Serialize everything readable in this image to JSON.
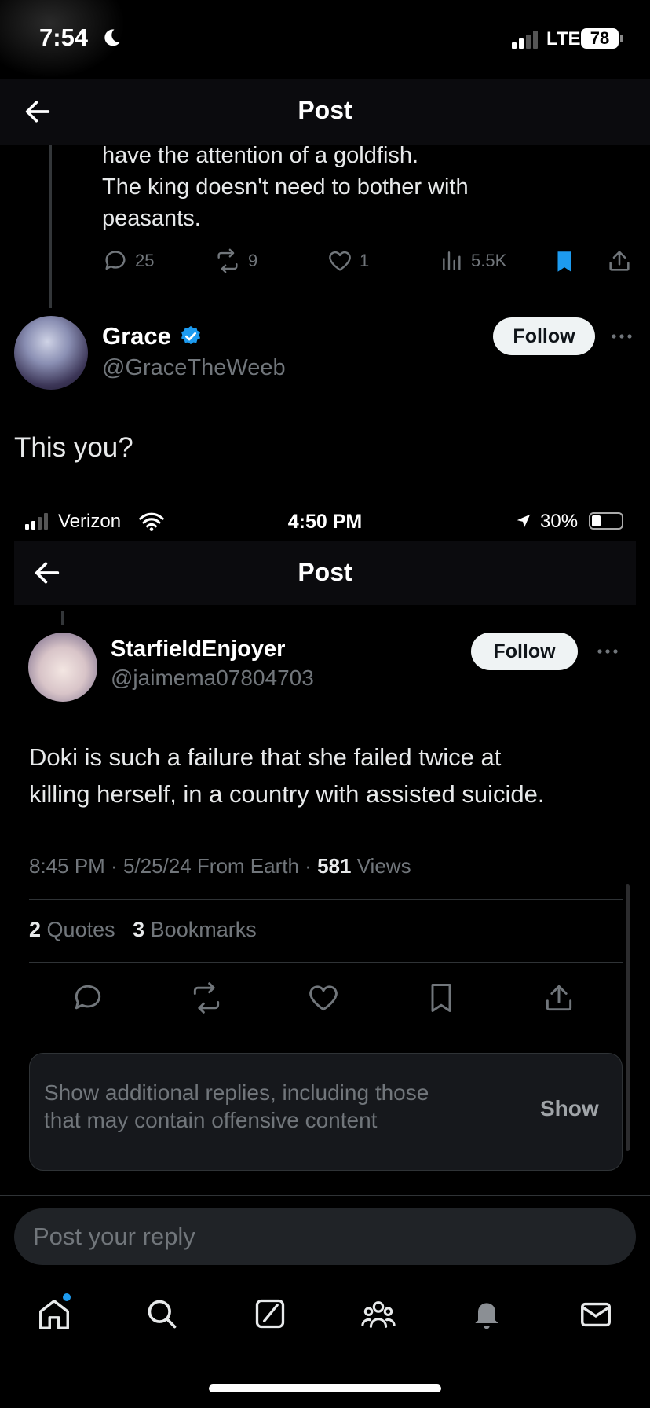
{
  "status_bar": {
    "time": "7:54",
    "network": "LTE",
    "battery": "78"
  },
  "header": {
    "title": "Post"
  },
  "prior_post": {
    "lines": [
      "have the attention of a goldfish.",
      "The king doesn't need to bother with",
      "peasants."
    ],
    "replies": "25",
    "reposts": "9",
    "likes": "1",
    "views": "5.5K"
  },
  "reply_post": {
    "display_name": "Grace",
    "handle": "@GraceTheWeeb",
    "follow_label": "Follow",
    "text": "This you?"
  },
  "embedded": {
    "status": {
      "carrier": "Verizon",
      "time": "4:50 PM",
      "battery": "30%"
    },
    "header_title": "Post",
    "author": {
      "display_name": "StarfieldEnjoyer",
      "handle": "@jaimema07804703",
      "follow_label": "Follow"
    },
    "text_line1": "Doki is such a failure that she failed twice at",
    "text_line2": "killing herself, in a country with assisted suicide.",
    "meta": {
      "time": "8:45 PM",
      "date": "5/25/24",
      "source": "From Earth",
      "views_count": "581",
      "views_label": "Views"
    },
    "stats": {
      "quotes_count": "2",
      "quotes_label": "Quotes",
      "bookmarks_count": "3",
      "bookmarks_label": "Bookmarks"
    },
    "notice": {
      "line1": "Show additional replies, including those",
      "line2": "that may contain offensive content",
      "button": "Show"
    }
  },
  "reply_box": {
    "placeholder": "Post your reply"
  },
  "colors": {
    "background": "#000000",
    "accent": "#1d9bf0",
    "muted": "#71767b",
    "bookmark_active": "#1d9bf0"
  },
  "icons": {
    "back": "arrow-left-icon",
    "verified": "verified-badge-icon",
    "more": "more-dots-icon",
    "reply": "reply-icon",
    "repost": "repost-icon",
    "like": "heart-icon",
    "views": "views-icon",
    "bookmark": "bookmark-icon",
    "share": "share-icon",
    "nav": [
      "home-icon",
      "search-icon",
      "grok-icon",
      "communities-icon",
      "notifications-icon",
      "messages-icon"
    ]
  }
}
